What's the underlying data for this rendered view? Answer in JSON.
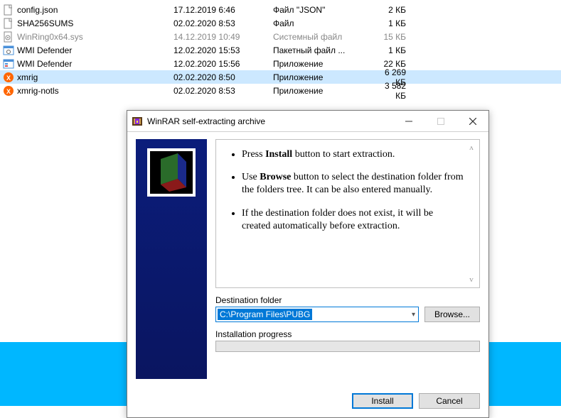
{
  "files": [
    {
      "name": "config.json",
      "date": "17.12.2019 6:46",
      "type": "Файл \"JSON\"",
      "size": "2 КБ",
      "icon": "file"
    },
    {
      "name": "SHA256SUMS",
      "date": "02.02.2020 8:53",
      "type": "Файл",
      "size": "1 КБ",
      "icon": "file"
    },
    {
      "name": "WinRing0x64.sys",
      "date": "14.12.2019 10:49",
      "type": "Системный файл",
      "size": "15 КБ",
      "icon": "sys",
      "dim": true
    },
    {
      "name": "WMI Defender",
      "date": "12.02.2020 15:53",
      "type": "Пакетный файл ...",
      "size": "1 КБ",
      "icon": "bat"
    },
    {
      "name": "WMI Defender",
      "date": "12.02.2020 15:56",
      "type": "Приложение",
      "size": "22 КБ",
      "icon": "exe"
    },
    {
      "name": "xmrig",
      "date": "02.02.2020 8:50",
      "type": "Приложение",
      "size": "6 269 КБ",
      "icon": "xmr",
      "selected": true
    },
    {
      "name": "xmrig-notls",
      "date": "02.02.2020 8:53",
      "type": "Приложение",
      "size": "3 582 КБ",
      "icon": "xmr"
    }
  ],
  "dialog": {
    "title": "WinRAR self-extracting archive",
    "instructions": {
      "press_pre": "Press ",
      "press_bold": "Install",
      "press_post": " button to start extraction.",
      "use_pre": "Use ",
      "use_bold": "Browse",
      "use_post": " button to select the destination folder from the folders tree. It can be also entered manually.",
      "ifdest": "If the destination folder does not exist, it will be created automatically before extraction."
    },
    "dest_label": "Destination folder",
    "dest_value": "C:\\Program Files\\PUBG",
    "browse": "Browse...",
    "progress_label": "Installation progress",
    "install": "Install",
    "cancel": "Cancel"
  }
}
